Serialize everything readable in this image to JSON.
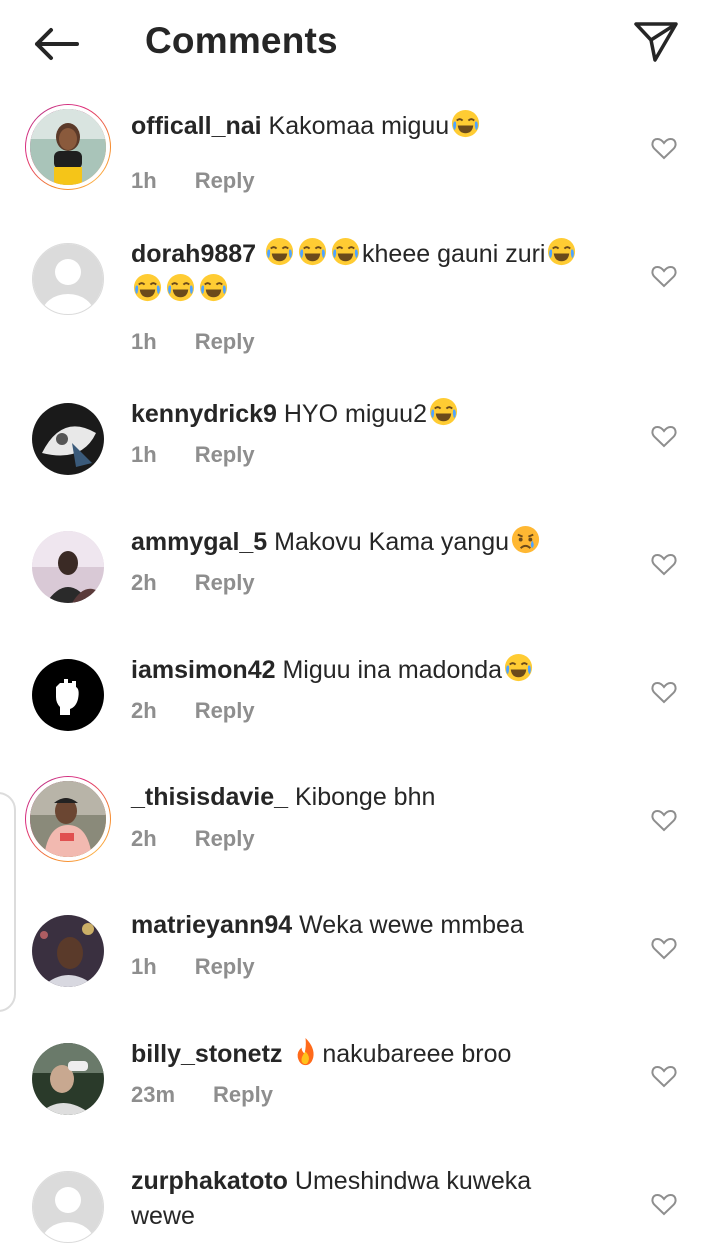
{
  "header": {
    "title": "Comments",
    "back_icon": "arrow-left-icon",
    "send_icon": "send-icon"
  },
  "comments": [
    {
      "username": "officall_nai",
      "text": "Kakomaa miguu",
      "emoji_after": "laugh",
      "time": "1h",
      "reply_label": "Reply",
      "story_ring": true
    },
    {
      "username": "dorah9887",
      "text": "kheee gauni zuri",
      "line2_emojis": 3,
      "time": "1h",
      "reply_label": "Reply"
    },
    {
      "username": "kennydrick9",
      "text": "HYO miguu2",
      "emoji_after": "laugh",
      "time": "1h",
      "reply_label": "Reply"
    },
    {
      "username": "ammygal_5",
      "text": "Makovu Kama yangu",
      "emoji_after": "sad",
      "time": "2h",
      "reply_label": "Reply"
    },
    {
      "username": "iamsimon42",
      "text": "Miguu ina madonda",
      "emoji_after": "laugh",
      "time": "2h",
      "reply_label": "Reply"
    },
    {
      "username": "_thisisdavie_",
      "text": "Kibonge bhn",
      "time": "2h",
      "reply_label": "Reply",
      "story_ring": true
    },
    {
      "username": "matrieyann94",
      "text": "Weka wewe mmbea",
      "time": "1h",
      "reply_label": "Reply"
    },
    {
      "username": "billy_stonetz",
      "text": "nakubareee broo",
      "emoji_before": "fire",
      "time": "23m",
      "reply_label": "Reply"
    },
    {
      "username": "zurphakatoto",
      "text": "Umeshindwa kuweka",
      "text_line2": "wewe"
    }
  ],
  "colors": {
    "text": "#262626",
    "meta": "#8e8e8e",
    "heart": "#8e8e8e",
    "story_ring_start": "#f58529",
    "story_ring_end": "#dd2a7b"
  }
}
